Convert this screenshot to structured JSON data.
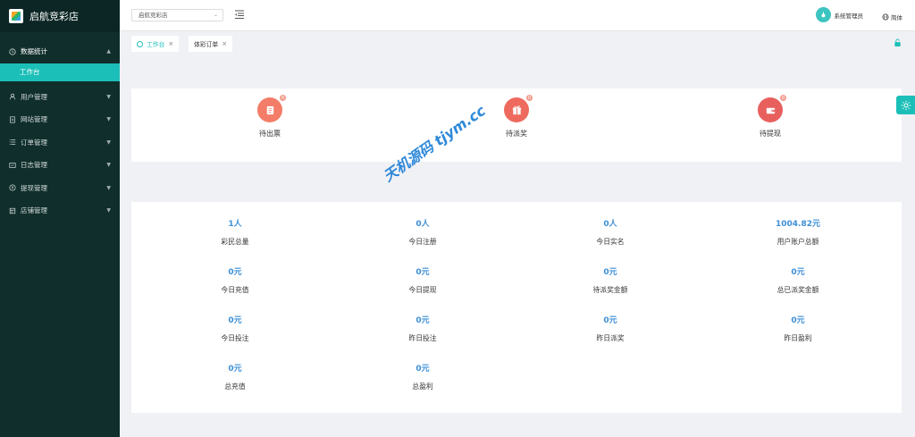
{
  "brand": {
    "title": "启航竞彩店"
  },
  "sidebar": {
    "items": [
      {
        "label": "数据统计",
        "icon": "clock-icon",
        "open": true
      },
      {
        "label": "用户管理",
        "icon": "user-icon"
      },
      {
        "label": "网站管理",
        "icon": "document-icon"
      },
      {
        "label": "订单管理",
        "icon": "list-icon"
      },
      {
        "label": "日志管理",
        "icon": "log-icon"
      },
      {
        "label": "提现管理",
        "icon": "coin-icon"
      },
      {
        "label": "店铺管理",
        "icon": "shop-icon"
      }
    ],
    "active_sub": "工作台"
  },
  "header": {
    "store_select": "启航竞彩店",
    "username": "系统管理员",
    "lang": "简体"
  },
  "tabs": [
    {
      "label": "工作台",
      "active": true
    },
    {
      "label": "体彩订单",
      "active": false
    }
  ],
  "pending": [
    {
      "label": "待出票",
      "badge": "0",
      "color": "#f37d68",
      "icon": "clipboard-icon"
    },
    {
      "label": "待派奖",
      "badge": "0",
      "color": "#ef6a5e",
      "icon": "gift-icon"
    },
    {
      "label": "待提现",
      "badge": "0",
      "color": "#e8605e",
      "icon": "wallet-icon"
    }
  ],
  "stats": [
    {
      "value": "1人",
      "label": "彩民总量"
    },
    {
      "value": "0人",
      "label": "今日注册"
    },
    {
      "value": "0人",
      "label": "今日实名"
    },
    {
      "value": "1004.82元",
      "label": "用户账户总额"
    },
    {
      "value": "0元",
      "label": "今日充值"
    },
    {
      "value": "0元",
      "label": "今日提现"
    },
    {
      "value": "0元",
      "label": "待派奖金额"
    },
    {
      "value": "0元",
      "label": "总已派奖金额"
    },
    {
      "value": "0元",
      "label": "今日投注"
    },
    {
      "value": "0元",
      "label": "昨日投注"
    },
    {
      "value": "0元",
      "label": "昨日派奖"
    },
    {
      "value": "0元",
      "label": "昨日盈利"
    },
    {
      "value": "0元",
      "label": "总充值"
    },
    {
      "value": "0元",
      "label": "总盈利"
    }
  ],
  "watermark": "天机源码 tjym.cc",
  "colors": {
    "accent": "#1cbfb8",
    "sidebar": "#0f2e2c",
    "stat_value": "#3d8fd6"
  }
}
